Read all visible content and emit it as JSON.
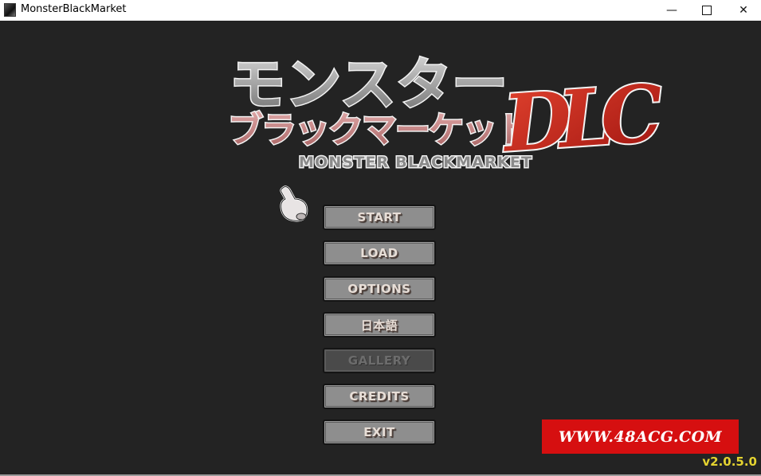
{
  "window": {
    "title": "MonsterBlackMarket",
    "controls": {
      "minimize": "—",
      "close": "✕"
    }
  },
  "logo": {
    "title_jp_line1": "モンスター",
    "title_jp_line2": "ブラックマーケット",
    "title_en": "MONSTER BLACKMARKET",
    "badge": "DLC",
    "colors": {
      "gray": "#9a9a9a",
      "pink": "#c98a8a",
      "red": "#c8261c"
    }
  },
  "cursor": {
    "icon": "pointing-hand-icon"
  },
  "menu": {
    "items": [
      {
        "label": "START",
        "enabled": true
      },
      {
        "label": "LOAD",
        "enabled": true
      },
      {
        "label": "OPTIONS",
        "enabled": true
      },
      {
        "label": "日本語",
        "enabled": true
      },
      {
        "label": "GALLERY",
        "enabled": false
      },
      {
        "label": "CREDITS",
        "enabled": true
      },
      {
        "label": "EXIT",
        "enabled": true
      }
    ]
  },
  "watermark": {
    "text": "WWW.48ACG.COM",
    "color": "#d60f10"
  },
  "version": {
    "text": "v2.0.5.0",
    "color": "#e4d330"
  }
}
